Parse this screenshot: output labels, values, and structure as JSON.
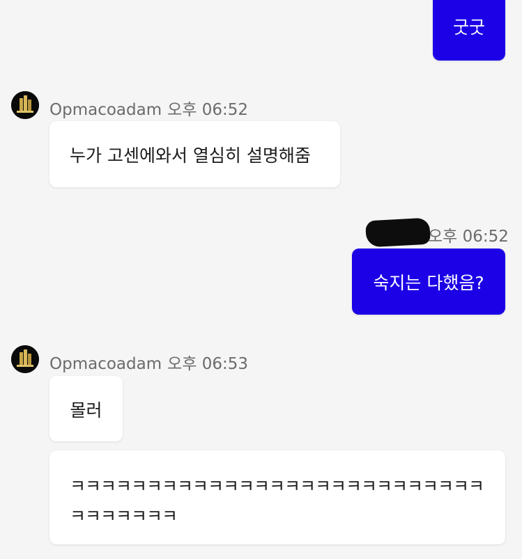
{
  "messages": [
    {
      "direction": "outgoing",
      "text": "굿굿"
    },
    {
      "direction": "incoming",
      "sender": "Opmacoadam",
      "time": "오후 06:52",
      "texts": [
        "누가 고센에와서 열심히 설명해줌"
      ]
    },
    {
      "direction": "outgoing",
      "time": "오후 06:52",
      "sender_redacted": true,
      "text": "숙지는 다했음?"
    },
    {
      "direction": "incoming",
      "sender": "Opmacoadam",
      "time": "오후 06:53",
      "texts": [
        "몰러",
        "ㅋㅋㅋㅋㅋㅋㅋㅋㅋㅋㅋㅋㅋㅋㅋㅋㅋㅋㅋㅋㅋㅋㅋㅋㅋㅋㅋ",
        "ㅋㅋㅋㅋㅋㅋㅋ"
      ]
    }
  ],
  "colors": {
    "outgoing_bubble": "#1c00e6",
    "incoming_bubble": "#ffffff",
    "background": "#f5f5f6",
    "meta_text": "#6b6b6b"
  },
  "icons": {
    "avatar": "building-logo-avatar"
  }
}
